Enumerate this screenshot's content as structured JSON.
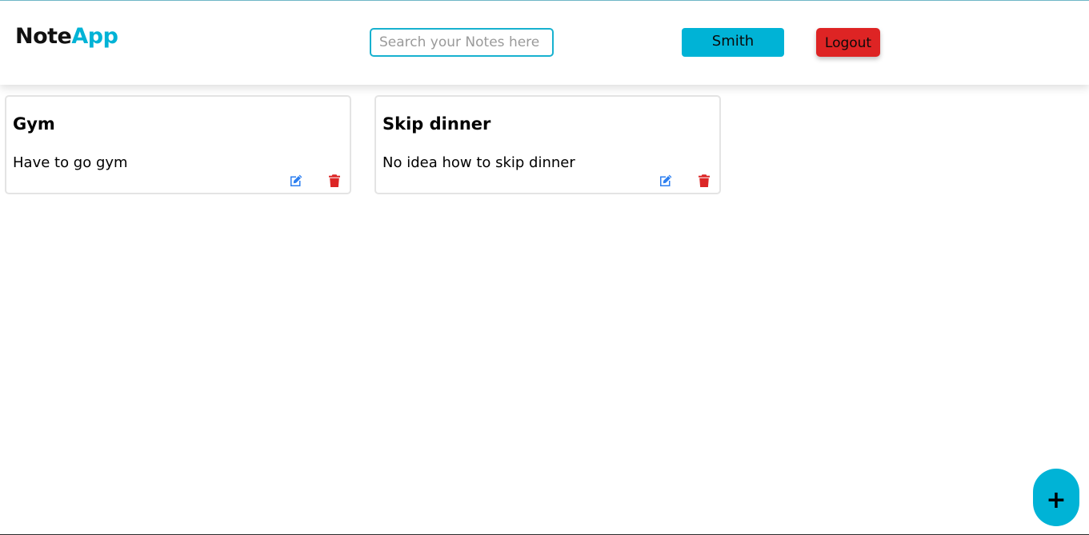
{
  "brand": {
    "part1": "Note",
    "part2": "App",
    "color_accent": "#00b3d6"
  },
  "search": {
    "placeholder": "Search your Notes here",
    "value": ""
  },
  "user": {
    "name": "Smith"
  },
  "logout": {
    "label": "Logout",
    "color": "#de2424"
  },
  "notes": [
    {
      "title": "Gym",
      "body": "Have to go gym",
      "edit_icon": "edit-icon",
      "delete_icon": "trash-icon"
    },
    {
      "title": "Skip dinner",
      "body": "No idea how to skip dinner",
      "edit_icon": "edit-icon",
      "delete_icon": "trash-icon"
    }
  ],
  "fab": {
    "label": "+",
    "icon": "plus-icon"
  },
  "colors": {
    "edit": "#2d7ff0",
    "delete": "#dc2626",
    "primary": "#00b3d6"
  }
}
